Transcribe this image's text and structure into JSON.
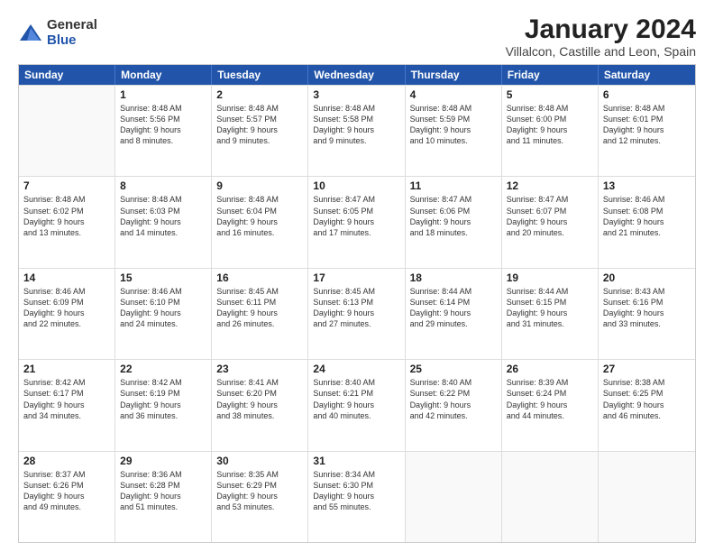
{
  "logo": {
    "general": "General",
    "blue": "Blue"
  },
  "title": "January 2024",
  "subtitle": "Villalcon, Castille and Leon, Spain",
  "calendar": {
    "headers": [
      "Sunday",
      "Monday",
      "Tuesday",
      "Wednesday",
      "Thursday",
      "Friday",
      "Saturday"
    ],
    "rows": [
      [
        {
          "day": "",
          "lines": []
        },
        {
          "day": "1",
          "lines": [
            "Sunrise: 8:48 AM",
            "Sunset: 5:56 PM",
            "Daylight: 9 hours",
            "and 8 minutes."
          ]
        },
        {
          "day": "2",
          "lines": [
            "Sunrise: 8:48 AM",
            "Sunset: 5:57 PM",
            "Daylight: 9 hours",
            "and 9 minutes."
          ]
        },
        {
          "day": "3",
          "lines": [
            "Sunrise: 8:48 AM",
            "Sunset: 5:58 PM",
            "Daylight: 9 hours",
            "and 9 minutes."
          ]
        },
        {
          "day": "4",
          "lines": [
            "Sunrise: 8:48 AM",
            "Sunset: 5:59 PM",
            "Daylight: 9 hours",
            "and 10 minutes."
          ]
        },
        {
          "day": "5",
          "lines": [
            "Sunrise: 8:48 AM",
            "Sunset: 6:00 PM",
            "Daylight: 9 hours",
            "and 11 minutes."
          ]
        },
        {
          "day": "6",
          "lines": [
            "Sunrise: 8:48 AM",
            "Sunset: 6:01 PM",
            "Daylight: 9 hours",
            "and 12 minutes."
          ]
        }
      ],
      [
        {
          "day": "7",
          "lines": [
            "Sunrise: 8:48 AM",
            "Sunset: 6:02 PM",
            "Daylight: 9 hours",
            "and 13 minutes."
          ]
        },
        {
          "day": "8",
          "lines": [
            "Sunrise: 8:48 AM",
            "Sunset: 6:03 PM",
            "Daylight: 9 hours",
            "and 14 minutes."
          ]
        },
        {
          "day": "9",
          "lines": [
            "Sunrise: 8:48 AM",
            "Sunset: 6:04 PM",
            "Daylight: 9 hours",
            "and 16 minutes."
          ]
        },
        {
          "day": "10",
          "lines": [
            "Sunrise: 8:47 AM",
            "Sunset: 6:05 PM",
            "Daylight: 9 hours",
            "and 17 minutes."
          ]
        },
        {
          "day": "11",
          "lines": [
            "Sunrise: 8:47 AM",
            "Sunset: 6:06 PM",
            "Daylight: 9 hours",
            "and 18 minutes."
          ]
        },
        {
          "day": "12",
          "lines": [
            "Sunrise: 8:47 AM",
            "Sunset: 6:07 PM",
            "Daylight: 9 hours",
            "and 20 minutes."
          ]
        },
        {
          "day": "13",
          "lines": [
            "Sunrise: 8:46 AM",
            "Sunset: 6:08 PM",
            "Daylight: 9 hours",
            "and 21 minutes."
          ]
        }
      ],
      [
        {
          "day": "14",
          "lines": [
            "Sunrise: 8:46 AM",
            "Sunset: 6:09 PM",
            "Daylight: 9 hours",
            "and 22 minutes."
          ]
        },
        {
          "day": "15",
          "lines": [
            "Sunrise: 8:46 AM",
            "Sunset: 6:10 PM",
            "Daylight: 9 hours",
            "and 24 minutes."
          ]
        },
        {
          "day": "16",
          "lines": [
            "Sunrise: 8:45 AM",
            "Sunset: 6:11 PM",
            "Daylight: 9 hours",
            "and 26 minutes."
          ]
        },
        {
          "day": "17",
          "lines": [
            "Sunrise: 8:45 AM",
            "Sunset: 6:13 PM",
            "Daylight: 9 hours",
            "and 27 minutes."
          ]
        },
        {
          "day": "18",
          "lines": [
            "Sunrise: 8:44 AM",
            "Sunset: 6:14 PM",
            "Daylight: 9 hours",
            "and 29 minutes."
          ]
        },
        {
          "day": "19",
          "lines": [
            "Sunrise: 8:44 AM",
            "Sunset: 6:15 PM",
            "Daylight: 9 hours",
            "and 31 minutes."
          ]
        },
        {
          "day": "20",
          "lines": [
            "Sunrise: 8:43 AM",
            "Sunset: 6:16 PM",
            "Daylight: 9 hours",
            "and 33 minutes."
          ]
        }
      ],
      [
        {
          "day": "21",
          "lines": [
            "Sunrise: 8:42 AM",
            "Sunset: 6:17 PM",
            "Daylight: 9 hours",
            "and 34 minutes."
          ]
        },
        {
          "day": "22",
          "lines": [
            "Sunrise: 8:42 AM",
            "Sunset: 6:19 PM",
            "Daylight: 9 hours",
            "and 36 minutes."
          ]
        },
        {
          "day": "23",
          "lines": [
            "Sunrise: 8:41 AM",
            "Sunset: 6:20 PM",
            "Daylight: 9 hours",
            "and 38 minutes."
          ]
        },
        {
          "day": "24",
          "lines": [
            "Sunrise: 8:40 AM",
            "Sunset: 6:21 PM",
            "Daylight: 9 hours",
            "and 40 minutes."
          ]
        },
        {
          "day": "25",
          "lines": [
            "Sunrise: 8:40 AM",
            "Sunset: 6:22 PM",
            "Daylight: 9 hours",
            "and 42 minutes."
          ]
        },
        {
          "day": "26",
          "lines": [
            "Sunrise: 8:39 AM",
            "Sunset: 6:24 PM",
            "Daylight: 9 hours",
            "and 44 minutes."
          ]
        },
        {
          "day": "27",
          "lines": [
            "Sunrise: 8:38 AM",
            "Sunset: 6:25 PM",
            "Daylight: 9 hours",
            "and 46 minutes."
          ]
        }
      ],
      [
        {
          "day": "28",
          "lines": [
            "Sunrise: 8:37 AM",
            "Sunset: 6:26 PM",
            "Daylight: 9 hours",
            "and 49 minutes."
          ]
        },
        {
          "day": "29",
          "lines": [
            "Sunrise: 8:36 AM",
            "Sunset: 6:28 PM",
            "Daylight: 9 hours",
            "and 51 minutes."
          ]
        },
        {
          "day": "30",
          "lines": [
            "Sunrise: 8:35 AM",
            "Sunset: 6:29 PM",
            "Daylight: 9 hours",
            "and 53 minutes."
          ]
        },
        {
          "day": "31",
          "lines": [
            "Sunrise: 8:34 AM",
            "Sunset: 6:30 PM",
            "Daylight: 9 hours",
            "and 55 minutes."
          ]
        },
        {
          "day": "",
          "lines": []
        },
        {
          "day": "",
          "lines": []
        },
        {
          "day": "",
          "lines": []
        }
      ]
    ]
  }
}
